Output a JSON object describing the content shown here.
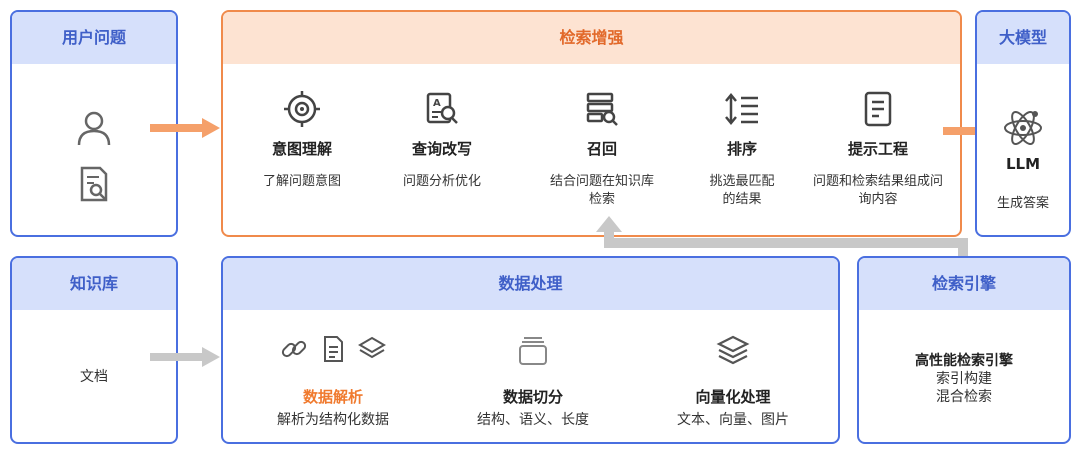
{
  "user_question": {
    "title": "用户问题"
  },
  "retrieval": {
    "title": "检索增强",
    "steps": [
      {
        "icon": "target-icon",
        "label": "意图理解",
        "desc": "了解问题意图"
      },
      {
        "icon": "rewrite-icon",
        "label": "查询改写",
        "desc": "问题分析优化"
      },
      {
        "icon": "database-search-icon",
        "label": "召回",
        "desc": "结合问题在知识库检索"
      },
      {
        "icon": "sort-list-icon",
        "label": "排序",
        "desc": "挑选最匹配的结果"
      },
      {
        "icon": "document-icon",
        "label": "提示工程",
        "desc": "问题和检索结果组成问询内容"
      }
    ]
  },
  "llm": {
    "title": "大模型",
    "model": "LLM",
    "desc": "生成答案"
  },
  "knowledge": {
    "title": "知识库",
    "item": "文档"
  },
  "processing": {
    "title": "数据处理",
    "items": [
      {
        "label": "数据解析",
        "desc": "解析为结构化数据"
      },
      {
        "label": "数据切分",
        "desc": "结构、语义、长度"
      },
      {
        "label": "向量化处理",
        "desc": "文本、向量、图片"
      }
    ]
  },
  "engine": {
    "title": "检索引擎",
    "lines": [
      "高性能检索引擎",
      "索引构建",
      "混合检索"
    ]
  },
  "colors": {
    "blue": "#4a6fe0",
    "orange": "#f08a4b",
    "highlight": "#f07a2e",
    "arrow_gray": "#c8c8c8"
  }
}
